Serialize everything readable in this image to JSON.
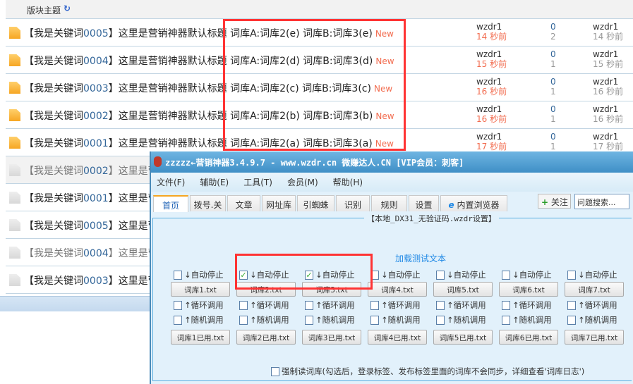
{
  "forum": {
    "header": "版块主题",
    "refresh_icon": "refresh-icon",
    "rows": [
      {
        "prefix": "【我是关键词",
        "num": "0005",
        "title": "】这里是营销神器默认标题 词库A:词库2(e) 词库B:词库3(e)",
        "new": "New",
        "author": "wzdr1",
        "time": "14 秒前",
        "replies": "0",
        "views": "2",
        "last": "wzdr1",
        "last_time": "14 秒前",
        "visited": false
      },
      {
        "prefix": "【我是关键词",
        "num": "0004",
        "title": "】这里是营销神器默认标题 词库A:词库2(d) 词库B:词库3(d)",
        "new": "New",
        "author": "wzdr1",
        "time": "15 秒前",
        "replies": "0",
        "views": "1",
        "last": "wzdr1",
        "last_time": "15 秒前",
        "visited": false
      },
      {
        "prefix": "【我是关键词",
        "num": "0003",
        "title": "】这里是营销神器默认标题 词库A:词库2(c) 词库B:词库3(c)",
        "new": "New",
        "author": "wzdr1",
        "time": "16 秒前",
        "replies": "0",
        "views": "1",
        "last": "wzdr1",
        "last_time": "16 秒前",
        "visited": false
      },
      {
        "prefix": "【我是关键词",
        "num": "0002",
        "title": "】这里是营销神器默认标题 词库A:词库2(b) 词库B:词库3(b)",
        "new": "New",
        "author": "wzdr1",
        "time": "16 秒前",
        "replies": "0",
        "views": "1",
        "last": "wzdr1",
        "last_time": "16 秒前",
        "visited": false
      },
      {
        "prefix": "【我是关键词",
        "num": "0001",
        "title": "】这里是营销神器默认标题 词库A:词库2(a) 词库B:词库3(a)",
        "new": "New",
        "author": "wzdr1",
        "time": "17 秒前",
        "replies": "0",
        "views": "1",
        "last": "wzdr1",
        "last_time": "17 秒前",
        "visited": false
      },
      {
        "prefix": "【我是关键词",
        "num": "0002",
        "title": "】这里是营",
        "visited": true
      },
      {
        "prefix": "【我是关键词",
        "num": "0001",
        "title": "】这里是营",
        "visited": false
      },
      {
        "prefix": "【我是关键词",
        "num": "0005",
        "title": "】这里是营",
        "visited": false
      },
      {
        "prefix": "【我是关键词",
        "num": "0004",
        "title": "】这里是营",
        "visited": true
      },
      {
        "prefix": "【我是关键词",
        "num": "0003",
        "title": "】这里是营",
        "visited": false
      }
    ]
  },
  "app": {
    "title": "zzzzz←营销神器3.4.9.7 - www.wzdr.cn 微赚达人.CN [VIP会员：刺客]",
    "menu": [
      "文件(F)",
      "辅助(E)",
      "工具(T)",
      "会员(M)",
      "帮助(H)"
    ],
    "tabs": [
      "首页",
      "拨号.关",
      "文章",
      "网址库",
      "引蜘蛛",
      "识别",
      "规则",
      "设置",
      "内置浏览器"
    ],
    "active_tab": "首页",
    "follow": "关注",
    "search_placeholder": "问题搜索...",
    "group_title": "【本地_DX31_无验证码.wzdr设置】",
    "load_test": "加载测试文本",
    "auto_stop": "↓自动停止",
    "cycle": "↑循环调用",
    "random": "↑随机调用",
    "libs": [
      {
        "file": "词库1.txt",
        "used": "词库1已用.txt",
        "auto_stop": false
      },
      {
        "file": "词库2.txt",
        "used": "词库2已用.txt",
        "auto_stop": true
      },
      {
        "file": "词库3.txt",
        "used": "词库3已用.txt",
        "auto_stop": true
      },
      {
        "file": "词库4.txt",
        "used": "词库4已用.txt",
        "auto_stop": false
      },
      {
        "file": "词库5.txt",
        "used": "词库5已用.txt",
        "auto_stop": false
      },
      {
        "file": "词库6.txt",
        "used": "词库6已用.txt",
        "auto_stop": false
      },
      {
        "file": "词库7.txt",
        "used": "词库7已用.txt",
        "auto_stop": false
      }
    ],
    "force_read": "强制读词库(勾选后，登录标签、发布标签里面的词库不会同步，详细查看'词库日志')"
  },
  "colors": {
    "accent": "#1e88e5",
    "new": "#f26c4f",
    "highlight": "#ff3333",
    "titlebar": "#3f8fc6"
  }
}
